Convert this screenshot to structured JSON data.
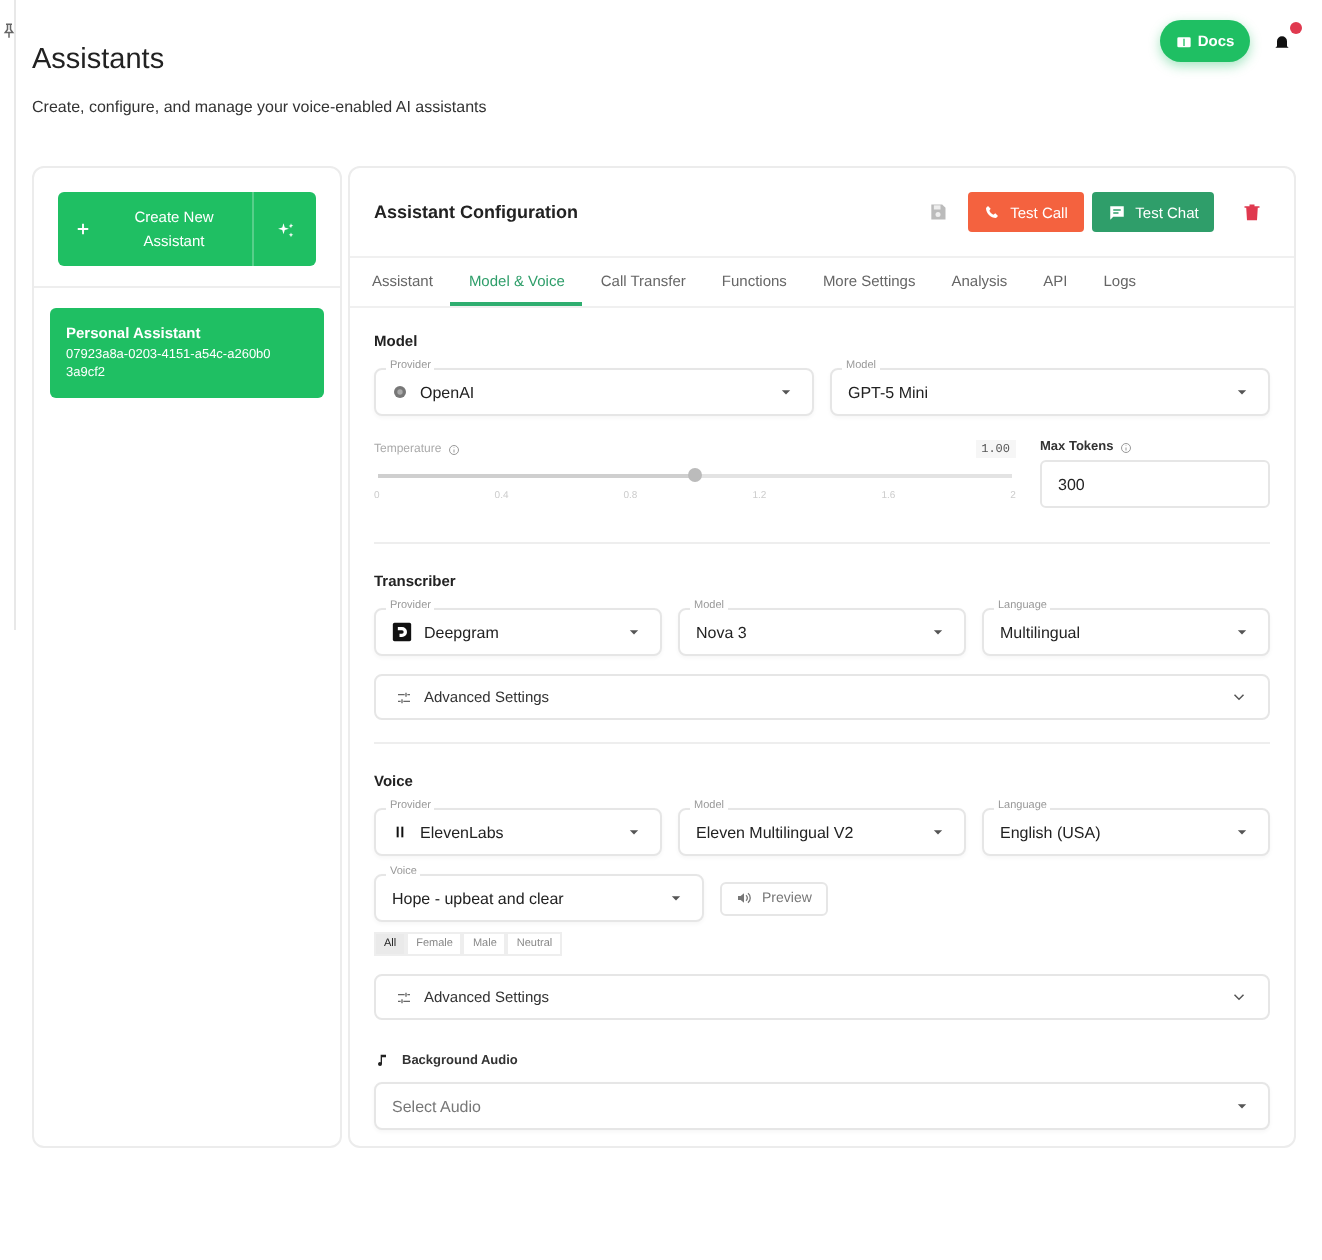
{
  "header": {
    "title": "Assistants",
    "subtitle": "Create, configure, and manage your voice-enabled AI assistants",
    "docs_button": "Docs",
    "notifications": {
      "unread": true
    }
  },
  "sidebar": {
    "create_button": "Create New Assistant",
    "assistants": [
      {
        "name": "Personal Assistant",
        "id": "07923a8a-0203-4151-a54c-a260b03a9cf2",
        "selected": true
      }
    ]
  },
  "config": {
    "title": "Assistant Configuration",
    "test_call": "Test Call",
    "test_chat": "Test Chat",
    "tabs": [
      {
        "label": "Assistant",
        "selected": false
      },
      {
        "label": "Model & Voice",
        "selected": true
      },
      {
        "label": "Call Transfer",
        "selected": false
      },
      {
        "label": "Functions",
        "selected": false
      },
      {
        "label": "More Settings",
        "selected": false
      },
      {
        "label": "Analysis",
        "selected": false
      },
      {
        "label": "API",
        "selected": false
      },
      {
        "label": "Logs",
        "selected": false
      }
    ],
    "model": {
      "title": "Model",
      "provider": {
        "label": "Provider",
        "value": "OpenAI"
      },
      "model": {
        "label": "Model",
        "value": "GPT-5 Mini"
      },
      "temperature": {
        "label": "Temperature",
        "reading": "1.00",
        "level": 0.5,
        "ticks": [
          "0",
          "0.4",
          "0.8",
          "1.2",
          "1.6",
          "2"
        ]
      },
      "max_tokens": {
        "label": "Max Tokens",
        "value": "300"
      }
    },
    "transcriber": {
      "title": "Transcriber",
      "provider": {
        "label": "Provider",
        "value": "Deepgram"
      },
      "model": {
        "label": "Model",
        "value": "Nova 3"
      },
      "language": {
        "label": "Language",
        "value": "Multilingual"
      },
      "advanced": {
        "label": "Advanced Settings",
        "expanded": false
      }
    },
    "voice": {
      "title": "Voice",
      "provider": {
        "label": "Provider",
        "value": "ElevenLabs"
      },
      "model": {
        "label": "Model",
        "value": "Eleven Multilingual V2"
      },
      "language": {
        "label": "Language",
        "value": "English (USA)"
      },
      "voice": {
        "label": "Voice",
        "value": "Hope - upbeat and clear"
      },
      "preview_button": "Preview",
      "filters": [
        {
          "label": "All",
          "selected": true
        },
        {
          "label": "Female",
          "selected": false
        },
        {
          "label": "Male",
          "selected": false
        },
        {
          "label": "Neutral",
          "selected": false
        }
      ],
      "advanced": {
        "label": "Advanced Settings",
        "expanded": false
      },
      "background_audio": {
        "label": "Background Audio",
        "placeholder": "Select Audio"
      }
    }
  }
}
